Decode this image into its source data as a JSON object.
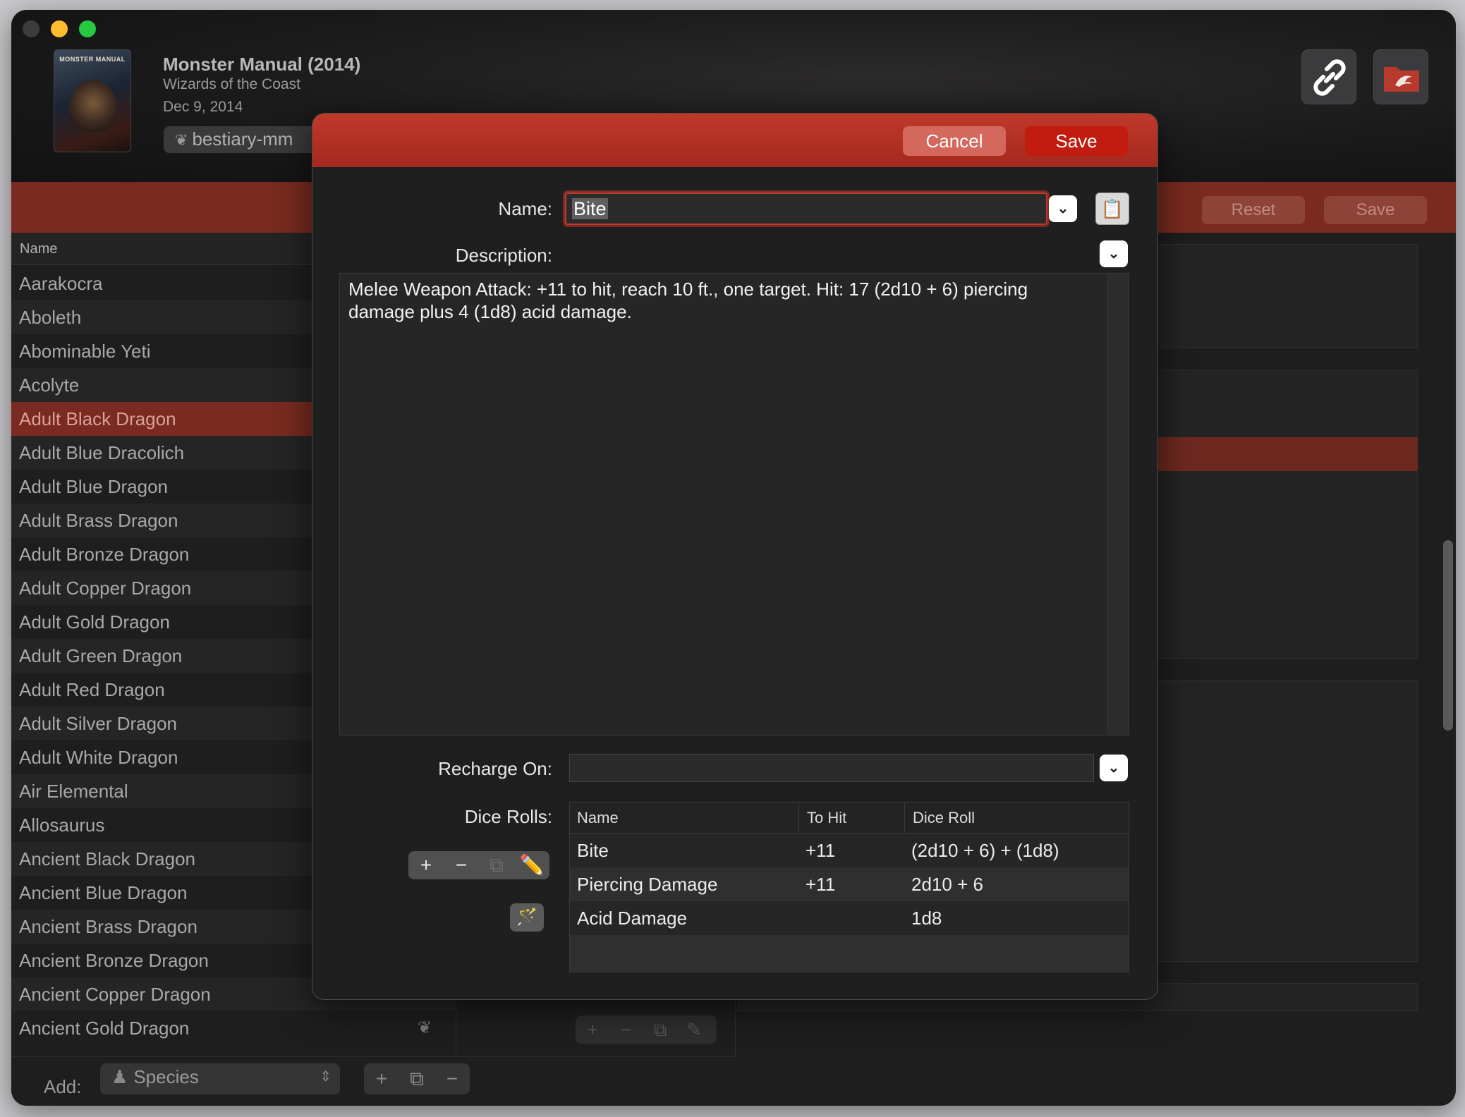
{
  "book": {
    "title": "Monster Manual (2014)",
    "publisher": "Wizards of the Coast",
    "date": "Dec 9, 2014",
    "source_tag": "bestiary-mm",
    "cover_title": "MONSTER MANUAL"
  },
  "header_buttons": {
    "link_icon": "link-icon",
    "folder_icon": "folder-icon"
  },
  "band": {
    "reset_label": "Reset",
    "save_label": "Save"
  },
  "list": {
    "column_header": "Name",
    "items": [
      "Aarakocra",
      "Aboleth",
      "Abominable Yeti",
      "Acolyte",
      "Adult Black Dragon",
      "Adult Blue Dracolich",
      "Adult Blue Dragon",
      "Adult Brass Dragon",
      "Adult Bronze Dragon",
      "Adult Copper Dragon",
      "Adult Gold Dragon",
      "Adult Green Dragon",
      "Adult Red Dragon",
      "Adult Silver Dragon",
      "Adult White Dragon",
      "Air Elemental",
      "Allosaurus",
      "Ancient Black Dragon",
      "Ancient Blue Dragon",
      "Ancient Brass Dragon",
      "Ancient Bronze Dragon",
      "Ancient Copper Dragon",
      "Ancient Gold Dragon"
    ],
    "selected": "Adult Black Dragon"
  },
  "footer": {
    "add_label": "Add:",
    "species_value": "Species"
  },
  "dialog": {
    "cancel_label": "Cancel",
    "save_label": "Save",
    "name_label": "Name:",
    "name_value": "Bite",
    "description_label": "Description:",
    "description_value": "Melee Weapon Attack: +11 to hit, reach 10 ft., one target. Hit: 17 (2d10 + 6) piercing damage plus 4 (1d8) acid damage.",
    "recharge_label": "Recharge On:",
    "recharge_value": "",
    "dice_label": "Dice Rolls:",
    "dice_columns": [
      "Name",
      "To Hit",
      "Dice Roll"
    ],
    "dice_rows": [
      {
        "name": "Bite",
        "to_hit": "+11",
        "dice": "(2d10 + 6) + (1d8)"
      },
      {
        "name": "Piercing Damage",
        "to_hit": "+11",
        "dice": "2d10 + 6"
      },
      {
        "name": "Acid Damage",
        "to_hit": "",
        "dice": "1d8"
      }
    ]
  }
}
